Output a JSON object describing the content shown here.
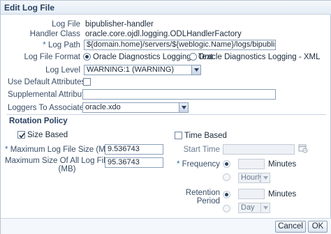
{
  "dialog": {
    "title": "Edit Log File"
  },
  "form": {
    "log_file": {
      "label": "Log File",
      "value": "bipublisher-handler"
    },
    "handler_class": {
      "label": "Handler Class",
      "value": "oracle.core.ojdl.logging.ODLHandlerFactory"
    },
    "log_path": {
      "required_mark": "*",
      "label": "Log Path",
      "value": "${domain.home}/servers/${weblogic.Name}/logs/bipublisher/bipul"
    },
    "log_file_format": {
      "label": "Log File Format",
      "options": [
        "Oracle Diagnostics Logging - Text",
        "Oracle Diagnostics Logging - XML"
      ],
      "selected": "Oracle Diagnostics Logging - Text"
    },
    "log_level": {
      "label": "Log Level",
      "value": "WARNING:1 (WARNING)"
    },
    "use_default_attributes": {
      "label": "Use Default Attributes",
      "checked": false
    },
    "supplemental_attributes": {
      "label": "Supplemental Attributes",
      "value": ""
    },
    "loggers_to_associate": {
      "label": "Loggers To Associate",
      "value": "oracle.xdo"
    }
  },
  "rotation": {
    "title": "Rotation Policy",
    "size_based": {
      "label": "Size Based",
      "checked": true
    },
    "max_log_file_size": {
      "required_mark": "*",
      "label": "Maximum Log File Size (MB)",
      "value": "9.536743"
    },
    "max_size_all": {
      "label_line1": "Maximum Size Of All Log Files",
      "label_line2": "(MB)",
      "value": "95.36743"
    },
    "time_based": {
      "label": "Time Based",
      "checked": false
    },
    "start_time": {
      "label": "Start Time",
      "value": ""
    },
    "frequency": {
      "required_mark": "*",
      "label": "Frequency",
      "minutes_label": "Minutes",
      "unit_value": "Hourly"
    },
    "retention_period": {
      "label_line1": "Retention",
      "label_line2": "Period",
      "minutes_label": "Minutes",
      "unit_value": "Day"
    }
  },
  "footer": {
    "cancel_label": "Cancel",
    "ok_label": "OK"
  },
  "colors": {
    "accent": "#2c6fb0",
    "title": "#2a4160",
    "border": "#8aa0b9"
  }
}
